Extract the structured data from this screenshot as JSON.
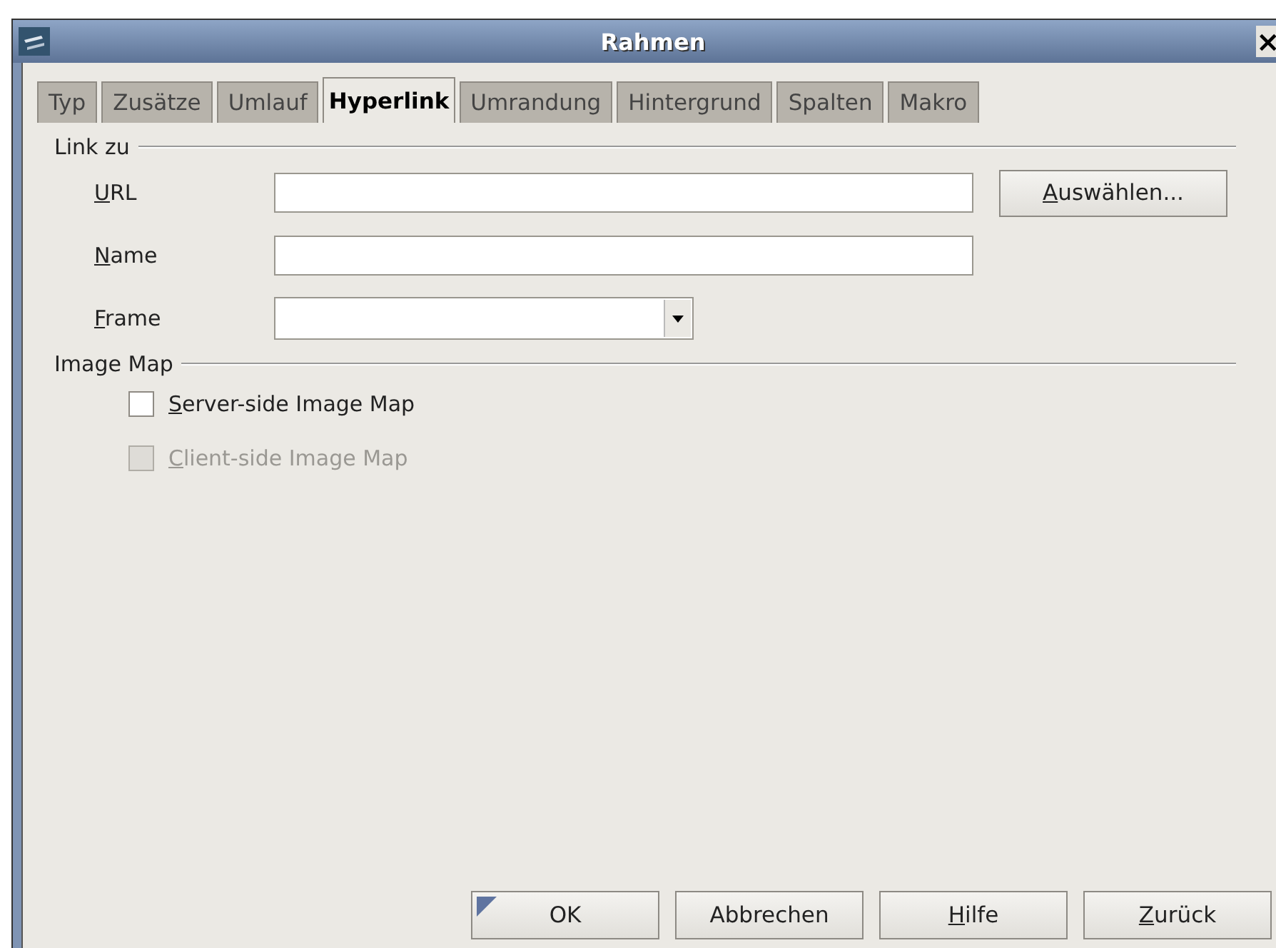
{
  "window": {
    "title": "Rahmen",
    "close": "×"
  },
  "tabs": [
    {
      "label": "Typ",
      "selected": false
    },
    {
      "label": "Zusätze",
      "selected": false
    },
    {
      "label": "Umlauf",
      "selected": false
    },
    {
      "label": "Hyperlink",
      "selected": true
    },
    {
      "label": "Umrandung",
      "selected": false
    },
    {
      "label": "Hintergrund",
      "selected": false
    },
    {
      "label": "Spalten",
      "selected": false
    },
    {
      "label": "Makro",
      "selected": false
    }
  ],
  "link_section": {
    "heading": "Link zu",
    "fields": [
      {
        "kind": "text",
        "label": "URL",
        "underline_first": true,
        "button": {
          "label": "Auswählen...",
          "underline_first": true
        }
      },
      {
        "kind": "text",
        "label": "Name",
        "underline_first": true
      },
      {
        "kind": "dropdown",
        "label": "Frame",
        "underline_first": true
      }
    ]
  },
  "image_map_section": {
    "heading": "Image Map",
    "options": [
      {
        "label": "Server-side Image Map",
        "checked": false,
        "disabled": false,
        "underline_first": true
      },
      {
        "label": "Client-side Image Map",
        "checked": false,
        "disabled": true,
        "underline_first": true
      }
    ]
  },
  "buttons": [
    {
      "label": "OK",
      "default": true,
      "underline_first": false
    },
    {
      "label": "Abbrechen",
      "default": false,
      "underline_first": false
    },
    {
      "label": "Hilfe",
      "default": false,
      "underline_first": true
    },
    {
      "label": "Zurück",
      "default": false,
      "underline_first": true
    }
  ]
}
